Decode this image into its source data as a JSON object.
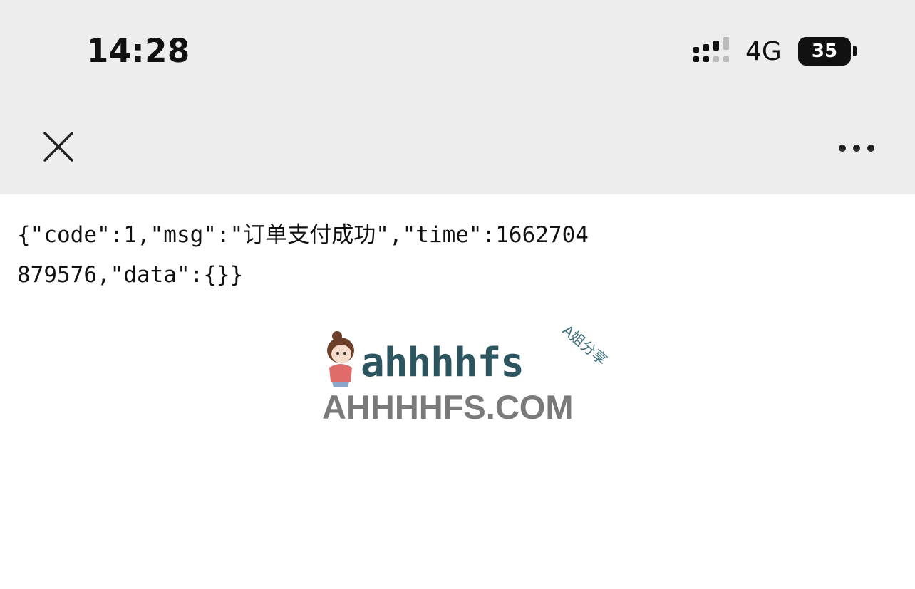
{
  "status_bar": {
    "time": "14:28",
    "network": "4G",
    "battery": "35"
  },
  "nav": {
    "close_icon": "close-icon",
    "more_icon": "more-horizontal-icon"
  },
  "content": {
    "response_text": "{\"code\":1,\"msg\":\"订单支付成功\",\"time\":1662704879576,\"data\":{}}"
  },
  "watermark": {
    "logo_text": "ahhhhfs",
    "tag_text": "A姐分享",
    "site_text": "AHHHHFS.COM"
  },
  "colors": {
    "top_bar_bg": "#ededed",
    "page_bg": "#ffffff",
    "text": "#111111"
  }
}
